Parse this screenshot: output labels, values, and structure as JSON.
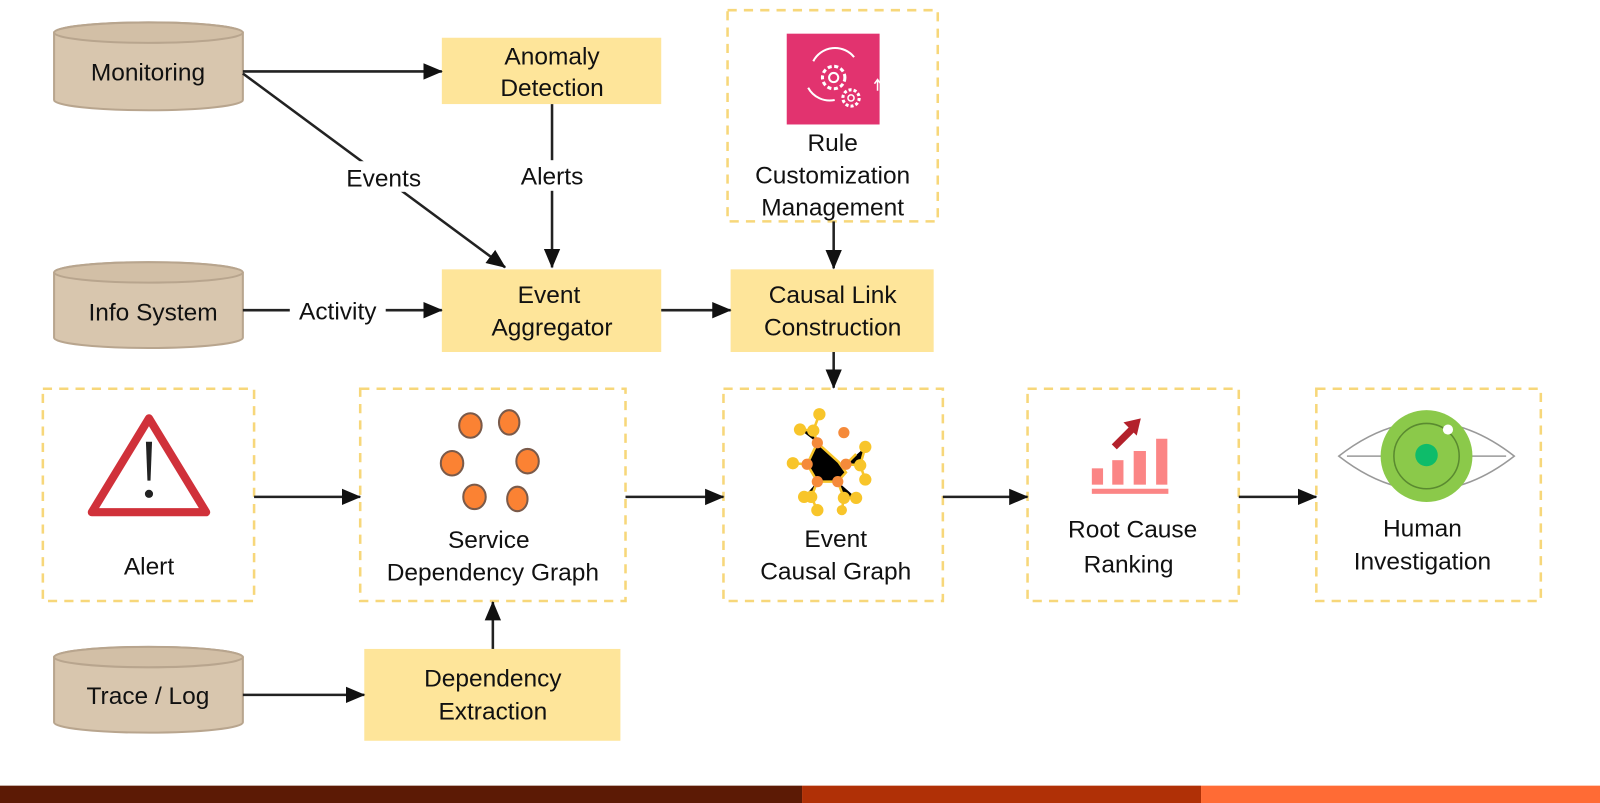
{
  "sources": {
    "monitoring": "Monitoring",
    "info_system": "Info System",
    "trace_log": "Trace / Log"
  },
  "processes": {
    "anomaly_detection": [
      "Anomaly",
      "Detection"
    ],
    "event_aggregator": [
      "Event",
      "Aggregator"
    ],
    "causal_link_construction": [
      "Causal Link",
      "Construction"
    ],
    "dependency_extraction": [
      "Dependency",
      "Extraction"
    ]
  },
  "artifacts": {
    "rule_customization": [
      "Rule",
      "Customization",
      "Management"
    ],
    "alert": "Alert",
    "service_dependency_graph": [
      "Service",
      "Dependency Graph"
    ],
    "event_causal_graph": [
      "Event",
      "Causal Graph"
    ],
    "root_cause_ranking": [
      "Root Cause",
      "Ranking"
    ],
    "human_investigation": [
      "Human",
      "Investigation"
    ]
  },
  "edge_labels": {
    "events": "Events",
    "alerts": "Alerts",
    "activity": "Activity"
  },
  "icons": {
    "rule": "gear-cycle-icon",
    "alert": "warning-triangle-icon",
    "service_graph": "node-ring-icon",
    "causal_graph": "molecule-graph-icon",
    "ranking": "bar-chart-up-icon",
    "investigation": "eye-icon"
  },
  "colors": {
    "process_box": "#fee59a",
    "dashed_border": "#f7d77a",
    "cylinder": "#d8c6ae",
    "footer": [
      "#5c1a05",
      "#b03006",
      "#ff6b35"
    ]
  }
}
